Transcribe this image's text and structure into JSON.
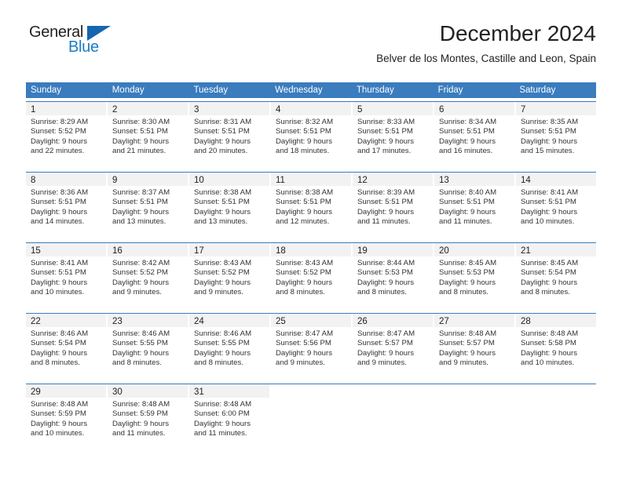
{
  "brand": {
    "name_top": "General",
    "name_bottom": "Blue",
    "triangle_color": "#1565b0",
    "blue_color": "#1a7dc4"
  },
  "header": {
    "month_title": "December 2024",
    "location": "Belver de los Montes, Castille and Leon, Spain"
  },
  "theme": {
    "header_bg": "#3a7cbe",
    "header_text": "#ffffff",
    "daynum_band": "#f2f2f2",
    "row_rule": "#3a7cbe"
  },
  "weekdays": [
    "Sunday",
    "Monday",
    "Tuesday",
    "Wednesday",
    "Thursday",
    "Friday",
    "Saturday"
  ],
  "weeks": [
    [
      {
        "day": "1",
        "sunrise": "Sunrise: 8:29 AM",
        "sunset": "Sunset: 5:52 PM",
        "daylight1": "Daylight: 9 hours",
        "daylight2": "and 22 minutes."
      },
      {
        "day": "2",
        "sunrise": "Sunrise: 8:30 AM",
        "sunset": "Sunset: 5:51 PM",
        "daylight1": "Daylight: 9 hours",
        "daylight2": "and 21 minutes."
      },
      {
        "day": "3",
        "sunrise": "Sunrise: 8:31 AM",
        "sunset": "Sunset: 5:51 PM",
        "daylight1": "Daylight: 9 hours",
        "daylight2": "and 20 minutes."
      },
      {
        "day": "4",
        "sunrise": "Sunrise: 8:32 AM",
        "sunset": "Sunset: 5:51 PM",
        "daylight1": "Daylight: 9 hours",
        "daylight2": "and 18 minutes."
      },
      {
        "day": "5",
        "sunrise": "Sunrise: 8:33 AM",
        "sunset": "Sunset: 5:51 PM",
        "daylight1": "Daylight: 9 hours",
        "daylight2": "and 17 minutes."
      },
      {
        "day": "6",
        "sunrise": "Sunrise: 8:34 AM",
        "sunset": "Sunset: 5:51 PM",
        "daylight1": "Daylight: 9 hours",
        "daylight2": "and 16 minutes."
      },
      {
        "day": "7",
        "sunrise": "Sunrise: 8:35 AM",
        "sunset": "Sunset: 5:51 PM",
        "daylight1": "Daylight: 9 hours",
        "daylight2": "and 15 minutes."
      }
    ],
    [
      {
        "day": "8",
        "sunrise": "Sunrise: 8:36 AM",
        "sunset": "Sunset: 5:51 PM",
        "daylight1": "Daylight: 9 hours",
        "daylight2": "and 14 minutes."
      },
      {
        "day": "9",
        "sunrise": "Sunrise: 8:37 AM",
        "sunset": "Sunset: 5:51 PM",
        "daylight1": "Daylight: 9 hours",
        "daylight2": "and 13 minutes."
      },
      {
        "day": "10",
        "sunrise": "Sunrise: 8:38 AM",
        "sunset": "Sunset: 5:51 PM",
        "daylight1": "Daylight: 9 hours",
        "daylight2": "and 13 minutes."
      },
      {
        "day": "11",
        "sunrise": "Sunrise: 8:38 AM",
        "sunset": "Sunset: 5:51 PM",
        "daylight1": "Daylight: 9 hours",
        "daylight2": "and 12 minutes."
      },
      {
        "day": "12",
        "sunrise": "Sunrise: 8:39 AM",
        "sunset": "Sunset: 5:51 PM",
        "daylight1": "Daylight: 9 hours",
        "daylight2": "and 11 minutes."
      },
      {
        "day": "13",
        "sunrise": "Sunrise: 8:40 AM",
        "sunset": "Sunset: 5:51 PM",
        "daylight1": "Daylight: 9 hours",
        "daylight2": "and 11 minutes."
      },
      {
        "day": "14",
        "sunrise": "Sunrise: 8:41 AM",
        "sunset": "Sunset: 5:51 PM",
        "daylight1": "Daylight: 9 hours",
        "daylight2": "and 10 minutes."
      }
    ],
    [
      {
        "day": "15",
        "sunrise": "Sunrise: 8:41 AM",
        "sunset": "Sunset: 5:51 PM",
        "daylight1": "Daylight: 9 hours",
        "daylight2": "and 10 minutes."
      },
      {
        "day": "16",
        "sunrise": "Sunrise: 8:42 AM",
        "sunset": "Sunset: 5:52 PM",
        "daylight1": "Daylight: 9 hours",
        "daylight2": "and 9 minutes."
      },
      {
        "day": "17",
        "sunrise": "Sunrise: 8:43 AM",
        "sunset": "Sunset: 5:52 PM",
        "daylight1": "Daylight: 9 hours",
        "daylight2": "and 9 minutes."
      },
      {
        "day": "18",
        "sunrise": "Sunrise: 8:43 AM",
        "sunset": "Sunset: 5:52 PM",
        "daylight1": "Daylight: 9 hours",
        "daylight2": "and 8 minutes."
      },
      {
        "day": "19",
        "sunrise": "Sunrise: 8:44 AM",
        "sunset": "Sunset: 5:53 PM",
        "daylight1": "Daylight: 9 hours",
        "daylight2": "and 8 minutes."
      },
      {
        "day": "20",
        "sunrise": "Sunrise: 8:45 AM",
        "sunset": "Sunset: 5:53 PM",
        "daylight1": "Daylight: 9 hours",
        "daylight2": "and 8 minutes."
      },
      {
        "day": "21",
        "sunrise": "Sunrise: 8:45 AM",
        "sunset": "Sunset: 5:54 PM",
        "daylight1": "Daylight: 9 hours",
        "daylight2": "and 8 minutes."
      }
    ],
    [
      {
        "day": "22",
        "sunrise": "Sunrise: 8:46 AM",
        "sunset": "Sunset: 5:54 PM",
        "daylight1": "Daylight: 9 hours",
        "daylight2": "and 8 minutes."
      },
      {
        "day": "23",
        "sunrise": "Sunrise: 8:46 AM",
        "sunset": "Sunset: 5:55 PM",
        "daylight1": "Daylight: 9 hours",
        "daylight2": "and 8 minutes."
      },
      {
        "day": "24",
        "sunrise": "Sunrise: 8:46 AM",
        "sunset": "Sunset: 5:55 PM",
        "daylight1": "Daylight: 9 hours",
        "daylight2": "and 8 minutes."
      },
      {
        "day": "25",
        "sunrise": "Sunrise: 8:47 AM",
        "sunset": "Sunset: 5:56 PM",
        "daylight1": "Daylight: 9 hours",
        "daylight2": "and 9 minutes."
      },
      {
        "day": "26",
        "sunrise": "Sunrise: 8:47 AM",
        "sunset": "Sunset: 5:57 PM",
        "daylight1": "Daylight: 9 hours",
        "daylight2": "and 9 minutes."
      },
      {
        "day": "27",
        "sunrise": "Sunrise: 8:48 AM",
        "sunset": "Sunset: 5:57 PM",
        "daylight1": "Daylight: 9 hours",
        "daylight2": "and 9 minutes."
      },
      {
        "day": "28",
        "sunrise": "Sunrise: 8:48 AM",
        "sunset": "Sunset: 5:58 PM",
        "daylight1": "Daylight: 9 hours",
        "daylight2": "and 10 minutes."
      }
    ],
    [
      {
        "day": "29",
        "sunrise": "Sunrise: 8:48 AM",
        "sunset": "Sunset: 5:59 PM",
        "daylight1": "Daylight: 9 hours",
        "daylight2": "and 10 minutes."
      },
      {
        "day": "30",
        "sunrise": "Sunrise: 8:48 AM",
        "sunset": "Sunset: 5:59 PM",
        "daylight1": "Daylight: 9 hours",
        "daylight2": "and 11 minutes."
      },
      {
        "day": "31",
        "sunrise": "Sunrise: 8:48 AM",
        "sunset": "Sunset: 6:00 PM",
        "daylight1": "Daylight: 9 hours",
        "daylight2": "and 11 minutes."
      },
      {
        "day": "",
        "sunrise": "",
        "sunset": "",
        "daylight1": "",
        "daylight2": ""
      },
      {
        "day": "",
        "sunrise": "",
        "sunset": "",
        "daylight1": "",
        "daylight2": ""
      },
      {
        "day": "",
        "sunrise": "",
        "sunset": "",
        "daylight1": "",
        "daylight2": ""
      },
      {
        "day": "",
        "sunrise": "",
        "sunset": "",
        "daylight1": "",
        "daylight2": ""
      }
    ]
  ]
}
